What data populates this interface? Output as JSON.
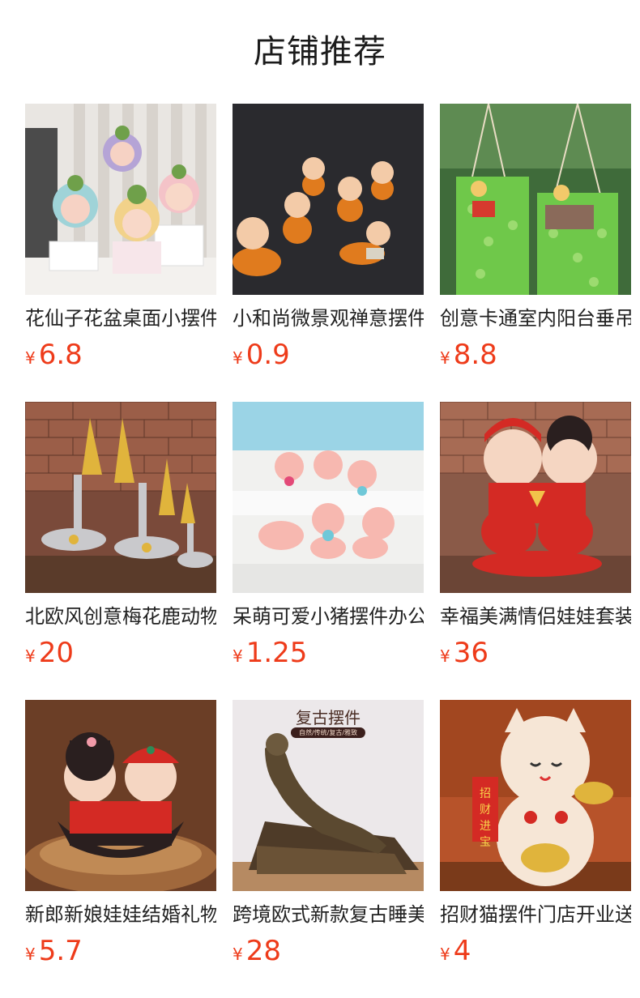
{
  "header": {
    "title": "店铺推荐"
  },
  "currency": "¥",
  "products": [
    {
      "name": "花仙子花盆桌面小摆件",
      "price": "6.8",
      "image": "fairy-flower-pots"
    },
    {
      "name": "小和尚微景观禅意摆件",
      "price": "0.9",
      "image": "little-monks"
    },
    {
      "name": "创意卡通室内阳台垂吊",
      "price": "8.8",
      "image": "hanging-plants"
    },
    {
      "name": "北欧风创意梅花鹿动物摆件",
      "price": "20",
      "image": "golden-deer"
    },
    {
      "name": "呆萌可爱小猪摆件办公",
      "price": "1.25",
      "image": "cute-pigs"
    },
    {
      "name": "幸福美满情侣娃娃套装",
      "price": "36",
      "image": "couple-dolls"
    },
    {
      "name": "新郎新娘娃娃结婚礼物",
      "price": "5.7",
      "image": "bride-groom-boat"
    },
    {
      "name": "跨境欧式新款复古睡美人",
      "price": "28",
      "image": "vintage-reclining-statue",
      "overlay_title": "复古摆件",
      "overlay_sub": "自然/传统/复古/雅致"
    },
    {
      "name": "招财猫摆件门店开业送礼",
      "price": "4",
      "image": "lucky-cat",
      "overlay_scroll": "招财进宝"
    }
  ]
}
